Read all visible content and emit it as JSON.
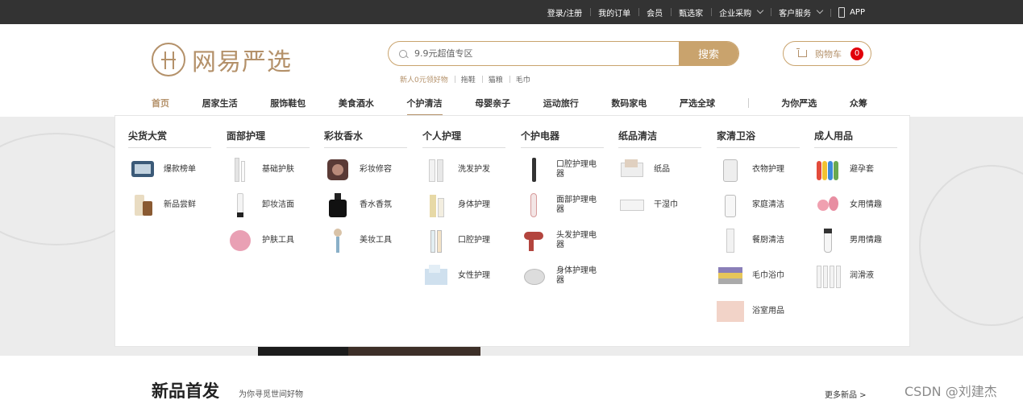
{
  "topbar": {
    "items": [
      {
        "label": "登录/注册"
      },
      {
        "label": "我的订单"
      },
      {
        "label": "会员"
      },
      {
        "label": "甄选家"
      },
      {
        "label": "企业采购",
        "icon": "chevron-down-icon"
      },
      {
        "label": "客户服务",
        "icon": "chevron-down-icon"
      },
      {
        "label": "APP",
        "icon": "phone-icon"
      }
    ]
  },
  "logo": {
    "text": "网易严选",
    "color": "#b4916a"
  },
  "search": {
    "placeholder": "9.9元超值专区",
    "button": "搜索",
    "hotwords": [
      "新人0元领好物",
      "拖鞋",
      "猫粮",
      "毛巾"
    ]
  },
  "cart": {
    "label": "购物车",
    "count": "0"
  },
  "nav": {
    "items": [
      {
        "label": "首页"
      },
      {
        "label": "居家生活"
      },
      {
        "label": "服饰鞋包"
      },
      {
        "label": "美食酒水"
      },
      {
        "label": "个护清洁"
      },
      {
        "label": "母婴亲子"
      },
      {
        "label": "运动旅行"
      },
      {
        "label": "数码家电"
      },
      {
        "label": "严选全球"
      },
      {
        "label": "为你严选"
      },
      {
        "label": "众筹"
      }
    ]
  },
  "dropdown": {
    "columns": [
      {
        "title": "尖货大赏",
        "items": [
          {
            "label": "爆款榜单"
          },
          {
            "label": "新品尝鲜"
          }
        ]
      },
      {
        "title": "面部护理",
        "items": [
          {
            "label": "基础护肤"
          },
          {
            "label": "卸妆洁面"
          },
          {
            "label": "护肤工具"
          }
        ]
      },
      {
        "title": "彩妆香水",
        "items": [
          {
            "label": "彩妆修容"
          },
          {
            "label": "香水香氛"
          },
          {
            "label": "美妆工具"
          }
        ]
      },
      {
        "title": "个人护理",
        "items": [
          {
            "label": "洗发护发"
          },
          {
            "label": "身体护理"
          },
          {
            "label": "口腔护理"
          },
          {
            "label": "女性护理"
          }
        ]
      },
      {
        "title": "个护电器",
        "items": [
          {
            "label": "口腔护理电器"
          },
          {
            "label": "面部护理电器"
          },
          {
            "label": "头发护理电器"
          },
          {
            "label": "身体护理电器"
          }
        ]
      },
      {
        "title": "纸品清洁",
        "items": [
          {
            "label": "纸品"
          },
          {
            "label": "干湿巾"
          }
        ]
      },
      {
        "title": "家清卫浴",
        "items": [
          {
            "label": "衣物护理"
          },
          {
            "label": "家庭清洁"
          },
          {
            "label": "餐厨清洁"
          },
          {
            "label": "毛巾浴巾"
          },
          {
            "label": "浴室用品"
          }
        ]
      },
      {
        "title": "成人用品",
        "items": [
          {
            "label": "避孕套"
          },
          {
            "label": "女用情趣"
          },
          {
            "label": "男用情趣"
          },
          {
            "label": "润滑液"
          }
        ]
      }
    ]
  },
  "section": {
    "title": "新品首发",
    "subtitle": "为你寻觅世间好物",
    "more": "更多新品 >"
  },
  "watermark": "CSDN @刘建杰",
  "colors": {
    "accent": "#c9a36d",
    "topbar": "#333333",
    "badge": "#e1000a"
  }
}
